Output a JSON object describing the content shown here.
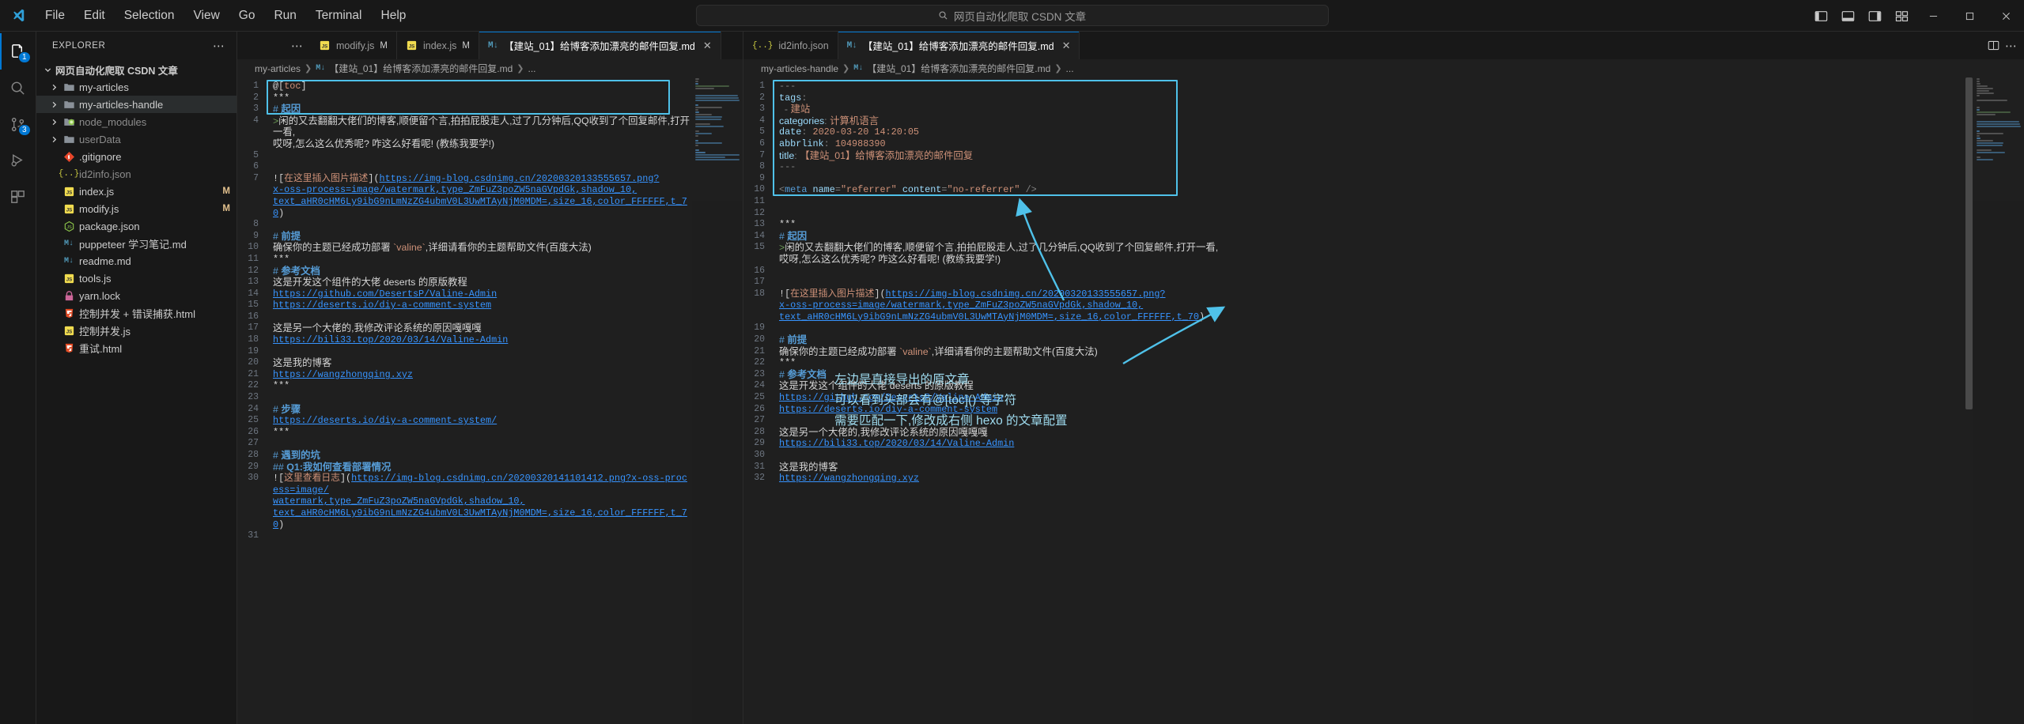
{
  "titlebar": {
    "menus": [
      "File",
      "Edit",
      "Selection",
      "View",
      "Go",
      "Run",
      "Terminal",
      "Help"
    ],
    "command_center_text": "网页自动化爬取 CSDN 文章",
    "window_controls": {
      "minimize": "–",
      "maximize": "□",
      "close": "✕"
    }
  },
  "activitybar": {
    "items": [
      {
        "name": "explorer",
        "badge": "1",
        "active": true
      },
      {
        "name": "search",
        "badge": "",
        "active": false
      },
      {
        "name": "source-control",
        "badge": "3",
        "active": false
      },
      {
        "name": "run-and-debug",
        "badge": "",
        "active": false
      },
      {
        "name": "extensions",
        "badge": "",
        "active": false
      }
    ]
  },
  "sidebar": {
    "title": "EXPLORER",
    "root": "网页自动化爬取 CSDN 文章",
    "items": [
      {
        "label": "my-articles",
        "type": "folder",
        "indent": 1,
        "expandable": true,
        "selected": false,
        "mark": ""
      },
      {
        "label": "my-articles-handle",
        "type": "folder",
        "indent": 1,
        "expandable": true,
        "selected": true,
        "mark": ""
      },
      {
        "label": "node_modules",
        "type": "node",
        "indent": 1,
        "expandable": true,
        "selected": false,
        "mark": ""
      },
      {
        "label": "userData",
        "type": "folder",
        "indent": 1,
        "expandable": true,
        "selected": false,
        "mark": ""
      },
      {
        "label": ".gitignore",
        "type": "git",
        "indent": 2,
        "expandable": false,
        "selected": false,
        "mark": ""
      },
      {
        "label": "id2info.json",
        "type": "json",
        "indent": 2,
        "expandable": false,
        "selected": false,
        "mark": ""
      },
      {
        "label": "index.js",
        "type": "js",
        "indent": 2,
        "expandable": false,
        "selected": false,
        "mark": "M"
      },
      {
        "label": "modify.js",
        "type": "js",
        "indent": 2,
        "expandable": false,
        "selected": false,
        "mark": "M"
      },
      {
        "label": "package.json",
        "type": "npm",
        "indent": 2,
        "expandable": false,
        "selected": false,
        "mark": ""
      },
      {
        "label": "puppeteer 学习笔记.md",
        "type": "md",
        "indent": 2,
        "expandable": false,
        "selected": false,
        "mark": ""
      },
      {
        "label": "readme.md",
        "type": "md",
        "indent": 2,
        "expandable": false,
        "selected": false,
        "mark": ""
      },
      {
        "label": "tools.js",
        "type": "js",
        "indent": 2,
        "expandable": false,
        "selected": false,
        "mark": ""
      },
      {
        "label": "yarn.lock",
        "type": "lock",
        "indent": 2,
        "expandable": false,
        "selected": false,
        "mark": ""
      },
      {
        "label": "控制并发 + 错误捕获.html",
        "type": "html",
        "indent": 2,
        "expandable": false,
        "selected": false,
        "mark": ""
      },
      {
        "label": "控制并发.js",
        "type": "js",
        "indent": 2,
        "expandable": false,
        "selected": false,
        "mark": ""
      },
      {
        "label": "重试.html",
        "type": "html",
        "indent": 2,
        "expandable": false,
        "selected": false,
        "mark": ""
      }
    ]
  },
  "left_group": {
    "tabs": [
      {
        "label": "modify.js",
        "icon": "js",
        "dirty": "M",
        "active": false,
        "closable": false
      },
      {
        "label": "index.js",
        "icon": "js",
        "dirty": "M",
        "active": false,
        "closable": false
      },
      {
        "label": "【建站_01】给博客添加漂亮的邮件回复.md",
        "icon": "md",
        "dirty": "",
        "active": true,
        "closable": true
      }
    ],
    "breadcrumb": [
      "my-articles",
      "【建站_01】给博客添加漂亮的邮件回复.md",
      "..."
    ],
    "lines": [
      {
        "n": "1",
        "segs": [
          {
            "c": "t-at",
            "t": "@"
          },
          {
            "c": "t-brk",
            "t": "["
          },
          {
            "c": "t-toc",
            "t": "toc"
          },
          {
            "c": "t-brk",
            "t": "]"
          }
        ]
      },
      {
        "n": "2",
        "segs": [
          {
            "c": "t-stars",
            "t": "***"
          }
        ]
      },
      {
        "n": "3",
        "segs": [
          {
            "c": "t-hash",
            "t": "# "
          },
          {
            "c": "t-head",
            "t": "起因"
          }
        ],
        "cn": true
      },
      {
        "n": "4",
        "segs": [
          {
            "c": "t-quote",
            "t": ">"
          },
          {
            "c": "t-md-plain",
            "t": "闲的又去翻翻大佬们的博客,顺便留个言,拍拍屁股走人,过了几分钟后,QQ收到了个回复邮件,打开一看,"
          }
        ],
        "cn": true
      },
      {
        "n": "",
        "segs": [
          {
            "c": "t-md-plain",
            "t": "哎呀,怎么这么优秀呢? 咋这么好看呢! (教练我要学!)"
          }
        ],
        "cn": true
      },
      {
        "n": "5",
        "segs": []
      },
      {
        "n": "6",
        "segs": []
      },
      {
        "n": "7",
        "segs": [
          {
            "c": "t-brk",
            "t": "!["
          },
          {
            "c": "t-alt",
            "t": "在这里插入图片描述"
          },
          {
            "c": "t-brk",
            "t": "]("
          },
          {
            "c": "t-url",
            "t": "https://img-blog.csdnimg.cn/20200320133555657.png?"
          }
        ]
      },
      {
        "n": "",
        "segs": [
          {
            "c": "t-url",
            "t": "x-oss-process=image/watermark,type_ZmFuZ3poZW5naGVpdGk,shadow_10,"
          }
        ]
      },
      {
        "n": "",
        "segs": [
          {
            "c": "t-url",
            "t": "text_aHR0cHM6Ly9ibG9nLmNzZG4ubmV0L3UwMTAyNjM0MDM=,size_16,color_FFFFFF,t_70"
          },
          {
            "c": "t-brk",
            "t": ")"
          }
        ]
      },
      {
        "n": "8",
        "segs": []
      },
      {
        "n": "9",
        "segs": [
          {
            "c": "t-hash",
            "t": "# "
          },
          {
            "c": "t-head",
            "t": "前提"
          }
        ],
        "cn": true
      },
      {
        "n": "10",
        "segs": [
          {
            "c": "t-md-plain",
            "t": "确保你的主题已经成功部署 "
          },
          {
            "c": "t-code",
            "t": "`valine`"
          },
          {
            "c": "t-md-plain",
            "t": ",详细请看你的主题帮助文件(百度大法)"
          }
        ],
        "cn": true
      },
      {
        "n": "11",
        "segs": [
          {
            "c": "t-stars",
            "t": "***"
          }
        ]
      },
      {
        "n": "12",
        "segs": [
          {
            "c": "t-hash",
            "t": "# "
          },
          {
            "c": "t-head",
            "t": "参考文档"
          }
        ],
        "cn": true
      },
      {
        "n": "13",
        "segs": [
          {
            "c": "t-md-plain",
            "t": "这是开发这个组件的大佬 deserts 的原版教程"
          }
        ],
        "cn": true
      },
      {
        "n": "14",
        "segs": [
          {
            "c": "t-url",
            "t": "https://github.com/DesertsP/Valine-Admin"
          }
        ]
      },
      {
        "n": "15",
        "segs": [
          {
            "c": "t-url",
            "t": "https://deserts.io/diy-a-comment-system"
          }
        ]
      },
      {
        "n": "16",
        "segs": []
      },
      {
        "n": "17",
        "segs": [
          {
            "c": "t-md-plain",
            "t": "这是另一个大佬的,我修改评论系统的原因嘎嘎嘎"
          }
        ],
        "cn": true
      },
      {
        "n": "18",
        "segs": [
          {
            "c": "t-url",
            "t": "https://bili33.top/2020/03/14/Valine-Admin"
          }
        ]
      },
      {
        "n": "19",
        "segs": []
      },
      {
        "n": "20",
        "segs": [
          {
            "c": "t-md-plain",
            "t": "这是我的博客"
          }
        ],
        "cn": true
      },
      {
        "n": "21",
        "segs": [
          {
            "c": "t-url",
            "t": "https://wangzhongqing.xyz"
          }
        ]
      },
      {
        "n": "22",
        "segs": [
          {
            "c": "t-stars",
            "t": "***"
          }
        ]
      },
      {
        "n": "23",
        "segs": []
      },
      {
        "n": "24",
        "segs": [
          {
            "c": "t-hash",
            "t": "# "
          },
          {
            "c": "t-head",
            "t": "步骤"
          }
        ],
        "cn": true
      },
      {
        "n": "25",
        "segs": [
          {
            "c": "t-url",
            "t": "https://deserts.io/diy-a-comment-system/"
          }
        ]
      },
      {
        "n": "26",
        "segs": [
          {
            "c": "t-stars",
            "t": "***"
          }
        ]
      },
      {
        "n": "27",
        "segs": []
      },
      {
        "n": "28",
        "segs": [
          {
            "c": "t-hash",
            "t": "# "
          },
          {
            "c": "t-head",
            "t": "遇到的坑"
          }
        ],
        "cn": true
      },
      {
        "n": "29",
        "segs": [
          {
            "c": "t-hash",
            "t": "## "
          },
          {
            "c": "t-head",
            "t": "Q1:我如何查看部署情况"
          }
        ],
        "cn": true
      },
      {
        "n": "30",
        "segs": [
          {
            "c": "t-brk",
            "t": "!["
          },
          {
            "c": "t-alt",
            "t": "这里查看日志"
          },
          {
            "c": "t-brk",
            "t": "]("
          },
          {
            "c": "t-url",
            "t": "https://img-blog.csdnimg.cn/20200320141101412.png?x-oss-process=image/"
          }
        ]
      },
      {
        "n": "",
        "segs": [
          {
            "c": "t-url",
            "t": "watermark,type_ZmFuZ3poZW5naGVpdGk,shadow_10,"
          }
        ]
      },
      {
        "n": "",
        "segs": [
          {
            "c": "t-url",
            "t": "text_aHR0cHM6Ly9ibG9nLmNzZG4ubmV0L3UwMTAyNjM0MDM=,size_16,color_FFFFFF,t_70"
          },
          {
            "c": "t-brk",
            "t": ")"
          }
        ]
      },
      {
        "n": "31",
        "segs": []
      }
    ]
  },
  "right_group": {
    "tabs": [
      {
        "label": "id2info.json",
        "icon": "json",
        "dirty": "",
        "active": false,
        "closable": false
      },
      {
        "label": "【建站_01】给博客添加漂亮的邮件回复.md",
        "icon": "md",
        "dirty": "",
        "active": true,
        "closable": true
      }
    ],
    "breadcrumb": [
      "my-articles-handle",
      "【建站_01】给博客添加漂亮的邮件回复.md",
      "..."
    ],
    "lines": [
      {
        "n": "1",
        "segs": [
          {
            "c": "t-dash",
            "t": "---"
          }
        ]
      },
      {
        "n": "2",
        "segs": [
          {
            "c": "t-key",
            "t": "tags"
          },
          {
            "c": "t-punc",
            "t": ":"
          }
        ]
      },
      {
        "n": "3",
        "segs": [
          {
            "c": "t-punc",
            "t": "  - "
          },
          {
            "c": "t-val",
            "t": "建站"
          }
        ],
        "cn": true
      },
      {
        "n": "4",
        "segs": [
          {
            "c": "t-key",
            "t": "categories"
          },
          {
            "c": "t-punc",
            "t": ": "
          },
          {
            "c": "t-val",
            "t": "计算机语言"
          }
        ],
        "cn": true
      },
      {
        "n": "5",
        "segs": [
          {
            "c": "t-key",
            "t": "date"
          },
          {
            "c": "t-punc",
            "t": ": "
          },
          {
            "c": "t-val",
            "t": "2020-03-20 14:20:05"
          }
        ]
      },
      {
        "n": "6",
        "segs": [
          {
            "c": "t-key",
            "t": "abbrlink"
          },
          {
            "c": "t-punc",
            "t": ": "
          },
          {
            "c": "t-val",
            "t": "104988390"
          }
        ]
      },
      {
        "n": "7",
        "segs": [
          {
            "c": "t-key",
            "t": "title"
          },
          {
            "c": "t-punc",
            "t": ": "
          },
          {
            "c": "t-val",
            "t": "【建站_01】给博客添加漂亮的邮件回复"
          }
        ],
        "cn": true
      },
      {
        "n": "8",
        "segs": [
          {
            "c": "t-dash",
            "t": "---"
          }
        ]
      },
      {
        "n": "9",
        "segs": []
      },
      {
        "n": "10",
        "segs": [
          {
            "c": "t-punc",
            "t": "<"
          },
          {
            "c": "t-tag",
            "t": "meta"
          },
          {
            "c": "t-md-plain",
            "t": " "
          },
          {
            "c": "t-attr",
            "t": "name"
          },
          {
            "c": "t-punc",
            "t": "="
          },
          {
            "c": "t-str",
            "t": "\"referrer\""
          },
          {
            "c": "t-md-plain",
            "t": " "
          },
          {
            "c": "t-attr",
            "t": "content"
          },
          {
            "c": "t-punc",
            "t": "="
          },
          {
            "c": "t-str",
            "t": "\"no-referrer\""
          },
          {
            "c": "t-punc",
            "t": " />"
          }
        ]
      },
      {
        "n": "11",
        "segs": []
      },
      {
        "n": "12",
        "segs": []
      },
      {
        "n": "13",
        "segs": [
          {
            "c": "t-stars",
            "t": "***"
          }
        ]
      },
      {
        "n": "14",
        "segs": [
          {
            "c": "t-hash",
            "t": "# "
          },
          {
            "c": "t-head",
            "t": "起因"
          }
        ],
        "cn": true
      },
      {
        "n": "15",
        "segs": [
          {
            "c": "t-quote",
            "t": ">"
          },
          {
            "c": "t-md-plain",
            "t": "闲的又去翻翻大佬们的博客,顺便留个言,拍拍屁股走人,过了几分钟后,QQ收到了个回复邮件,打开一看,"
          }
        ],
        "cn": true
      },
      {
        "n": "",
        "segs": [
          {
            "c": "t-md-plain",
            "t": "哎呀,怎么这么优秀呢? 咋这么好看呢! (教练我要学!)"
          }
        ],
        "cn": true
      },
      {
        "n": "16",
        "segs": []
      },
      {
        "n": "17",
        "segs": []
      },
      {
        "n": "18",
        "segs": [
          {
            "c": "t-brk",
            "t": "!["
          },
          {
            "c": "t-alt",
            "t": "在这里插入图片描述"
          },
          {
            "c": "t-brk",
            "t": "]("
          },
          {
            "c": "t-url",
            "t": "https://img-blog.csdnimg.cn/20200320133555657.png?"
          }
        ]
      },
      {
        "n": "",
        "segs": [
          {
            "c": "t-url",
            "t": "x-oss-process=image/watermark,type_ZmFuZ3poZW5naGVpdGk,shadow_10,"
          }
        ]
      },
      {
        "n": "",
        "segs": [
          {
            "c": "t-url",
            "t": "text_aHR0cHM6Ly9ibG9nLmNzZG4ubmV0L3UwMTAyNjM0MDM=,size_16,color_FFFFFF,t_70"
          },
          {
            "c": "t-brk",
            "t": ")"
          }
        ]
      },
      {
        "n": "19",
        "segs": []
      },
      {
        "n": "20",
        "segs": [
          {
            "c": "t-hash",
            "t": "# "
          },
          {
            "c": "t-head",
            "t": "前提"
          }
        ],
        "cn": true
      },
      {
        "n": "21",
        "segs": [
          {
            "c": "t-md-plain",
            "t": "确保你的主题已经成功部署 "
          },
          {
            "c": "t-code",
            "t": "`valine`"
          },
          {
            "c": "t-md-plain",
            "t": ",详细请看你的主题帮助文件(百度大法)"
          }
        ],
        "cn": true
      },
      {
        "n": "22",
        "segs": [
          {
            "c": "t-stars",
            "t": "***"
          }
        ]
      },
      {
        "n": "23",
        "segs": [
          {
            "c": "t-hash",
            "t": "# "
          },
          {
            "c": "t-head",
            "t": "参考文档"
          }
        ],
        "cn": true
      },
      {
        "n": "24",
        "segs": [
          {
            "c": "t-md-plain",
            "t": "这是开发这个组件的大佬 deserts 的原版教程"
          }
        ],
        "cn": true
      },
      {
        "n": "25",
        "segs": [
          {
            "c": "t-url",
            "t": "https://github.com/DesertsP/Valine-Admin"
          }
        ]
      },
      {
        "n": "26",
        "segs": [
          {
            "c": "t-url",
            "t": "https://deserts.io/diy-a-comment-system"
          }
        ]
      },
      {
        "n": "27",
        "segs": []
      },
      {
        "n": "28",
        "segs": [
          {
            "c": "t-md-plain",
            "t": "这是另一个大佬的,我修改评论系统的原因嘎嘎嘎"
          }
        ],
        "cn": true
      },
      {
        "n": "29",
        "segs": [
          {
            "c": "t-url",
            "t": "https://bili33.top/2020/03/14/Valine-Admin"
          }
        ]
      },
      {
        "n": "30",
        "segs": []
      },
      {
        "n": "31",
        "segs": [
          {
            "c": "t-md-plain",
            "t": "这是我的博客"
          }
        ],
        "cn": true
      },
      {
        "n": "32",
        "segs": [
          {
            "c": "t-url",
            "t": "https://wangzhongqing.xyz"
          }
        ]
      }
    ]
  },
  "annotations": {
    "lines": [
      "左边是直接导出的原文章",
      "可以看到头部会有@[toc]() 等字符",
      "需要匹配一下,修改成右侧 hexo 的文章配置"
    ],
    "arrow_color": "#4fc1e9"
  }
}
